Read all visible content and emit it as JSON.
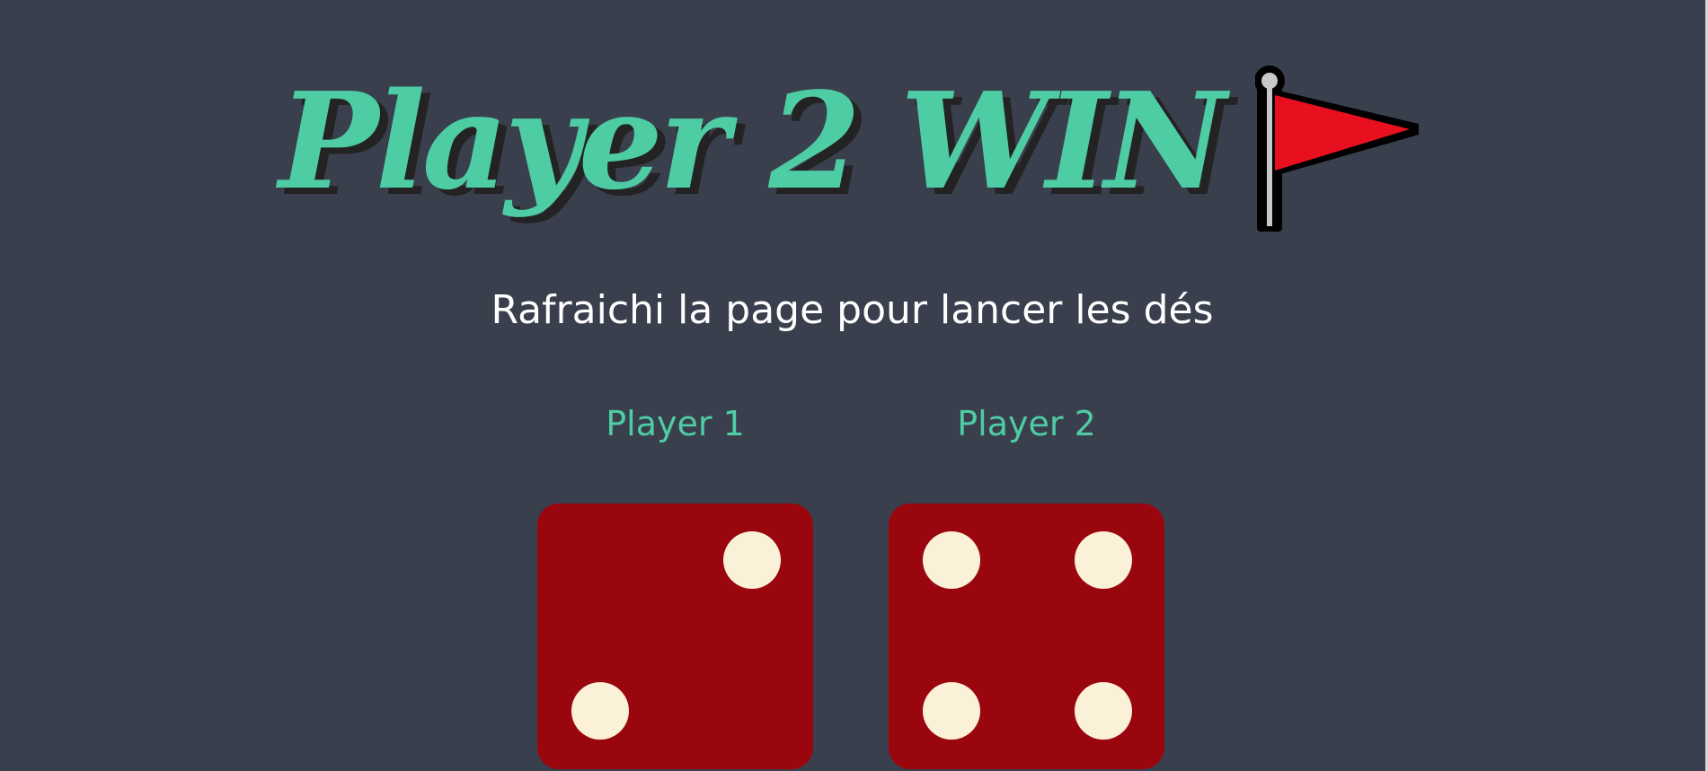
{
  "header": {
    "title": "Player 2 WIN",
    "title_icon": "red-flag-icon"
  },
  "instructions": "Rafraichi la page pour lancer les dés",
  "players": [
    {
      "label": "Player 1",
      "die_value": 2
    },
    {
      "label": "Player 2",
      "die_value": 4
    }
  ],
  "colors": {
    "background": "#393f4d",
    "accent": "#4ecca3",
    "die_face": "#9a060e",
    "pip": "#fbf0d8",
    "flag": "#e8101f"
  }
}
